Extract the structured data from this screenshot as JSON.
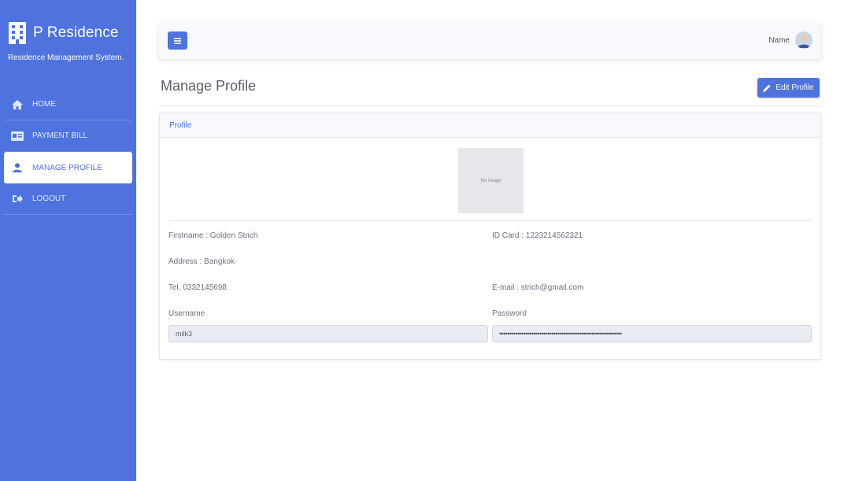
{
  "sidebar": {
    "brand_name": "P Residence",
    "brand_subtitle": "Residence Management System.",
    "items": [
      {
        "label": "HOME",
        "icon": "home-icon",
        "active": false
      },
      {
        "label": "PAYMENT BILL",
        "icon": "id-card-icon",
        "active": false
      },
      {
        "label": "MANAGE PROFILE",
        "icon": "user-icon",
        "active": true
      },
      {
        "label": "LOGOUT",
        "icon": "sign-out-icon",
        "active": false
      }
    ]
  },
  "topbar": {
    "user_name": "Name"
  },
  "page": {
    "title": "Manage Profile",
    "edit_button": "Edit Profile"
  },
  "card": {
    "header": "Profile",
    "photo_placeholder": "No Image",
    "firstname": "Firstname : Golden   Strich",
    "id_card": "ID Card : 1223214562321",
    "address": "Address : Bangkok",
    "tel": "Tel. 0332145698",
    "email": "E-mail : strich@gmail.com",
    "username_label": "Username",
    "username_value": "milk3",
    "password_label": "Password",
    "password_value": "•••••••••••••••••••••••••••••••••••••••••••••••••••••••••••••"
  },
  "colors": {
    "primary": "#4e73df",
    "topbar_bg": "#f8f9fc",
    "input_bg": "#eaecf4"
  }
}
